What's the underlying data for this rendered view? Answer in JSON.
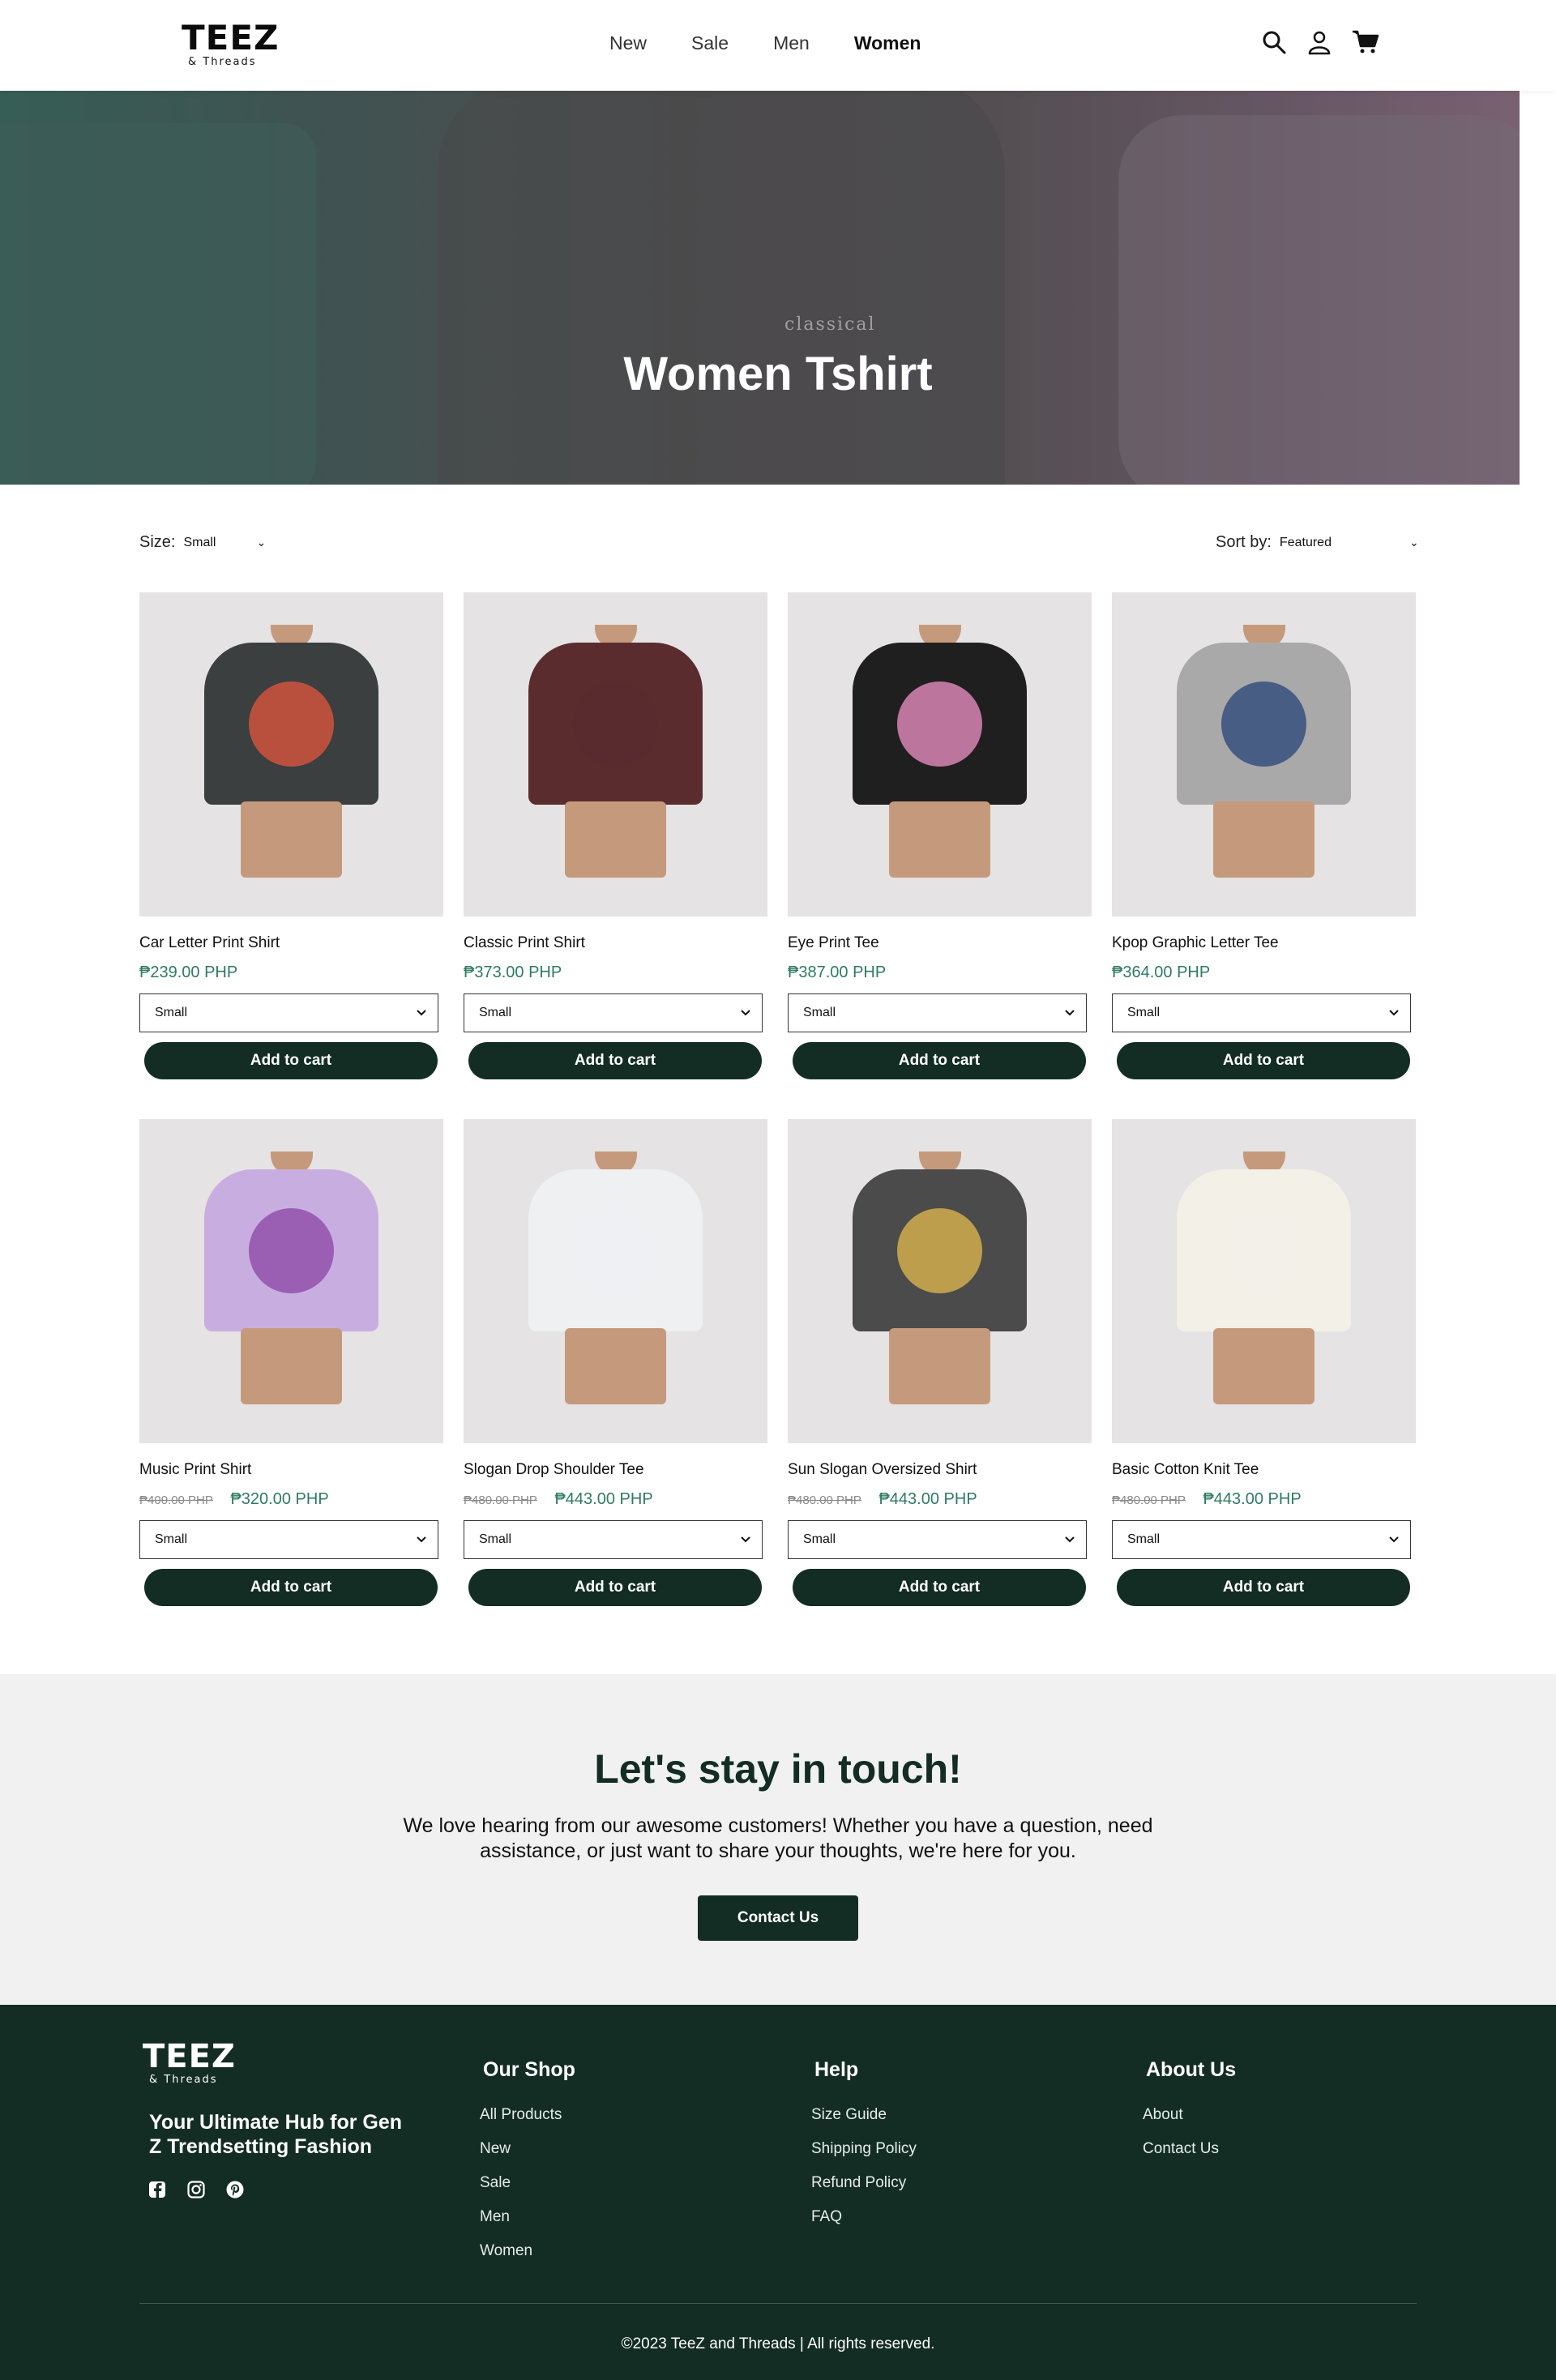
{
  "brand": {
    "name": "TEEZ",
    "sub": "& Threads"
  },
  "nav": [
    {
      "label": "New"
    },
    {
      "label": "Sale"
    },
    {
      "label": "Men"
    },
    {
      "label": "Women"
    }
  ],
  "header_icons": [
    "search-icon",
    "user-icon",
    "cart-icon"
  ],
  "hero": {
    "title": "Women Tshirt",
    "deco_text": "classical"
  },
  "filters": {
    "size_label": "Size:",
    "size_value": "Small",
    "sort_label": "Sort by:",
    "sort_value": "Featured"
  },
  "products": [
    {
      "name": "Car Letter Print Shirt",
      "price": "₱239.00 PHP",
      "old_price": "",
      "size": "Small",
      "button": "Add to cart",
      "tee_color": "#3c3f3f",
      "print_color": "#d8553f"
    },
    {
      "name": "Classic Print Shirt",
      "price": "₱373.00 PHP",
      "old_price": "",
      "size": "Small",
      "button": "Add to cart",
      "tee_color": "#5a2c2e",
      "print_color": "#5a2c2e"
    },
    {
      "name": "Eye Print Tee",
      "price": "₱387.00 PHP",
      "old_price": "",
      "size": "Small",
      "button": "Add to cart",
      "tee_color": "#1f1f1f",
      "print_color": "#e48bbd"
    },
    {
      "name": "Kpop Graphic Letter Tee",
      "price": "₱364.00 PHP",
      "old_price": "",
      "size": "Small",
      "button": "Add to cart",
      "tee_color": "#a9a9aa",
      "print_color": "#2f4a7a"
    },
    {
      "name": "Music Print Shirt",
      "price": "₱320.00 PHP",
      "old_price": "₱400.00 PHP",
      "size": "Small",
      "button": "Add to cart",
      "tee_color": "#c8aee0",
      "print_color": "#8e4aa8"
    },
    {
      "name": "Slogan Drop Shoulder Tee",
      "price": "₱443.00 PHP",
      "old_price": "₱480.00 PHP",
      "size": "Small",
      "button": "Add to cart",
      "tee_color": "#eef0f2",
      "print_color": "#eef0f2"
    },
    {
      "name": "Sun Slogan Oversized Shirt",
      "price": "₱443.00 PHP",
      "old_price": "₱480.00 PHP",
      "size": "Small",
      "button": "Add to cart",
      "tee_color": "#4b4b4b",
      "print_color": "#d9b34d"
    },
    {
      "name": "Basic Cotton Knit Tee",
      "price": "₱443.00 PHP",
      "old_price": "₱480.00 PHP",
      "size": "Small",
      "button": "Add to cart",
      "tee_color": "#f3f0e8",
      "print_color": "#f3f0e8"
    }
  ],
  "contact": {
    "title": "Let's stay in touch!",
    "text": "We love hearing from our awesome customers! Whether you have a question, need assistance, or just want to share your thoughts, we're here for you.",
    "button": "Contact Us"
  },
  "footer": {
    "tagline": "Your Ultimate Hub for Gen Z Trendsetting Fashion",
    "social": [
      "facebook-icon",
      "instagram-icon",
      "pinterest-icon"
    ],
    "columns": [
      {
        "title": "Our Shop",
        "links": [
          "All Products",
          "New",
          "Sale",
          "Men",
          "Women"
        ]
      },
      {
        "title": "Help",
        "links": [
          "Size Guide",
          "Shipping Policy",
          "Refund Policy",
          "FAQ"
        ]
      },
      {
        "title": "About Us",
        "links": [
          "About",
          "Contact Us"
        ]
      }
    ],
    "copyright": "©2023 TeeZ and Threads | All rights reserved."
  },
  "colors": {
    "accent": "#132d24",
    "price": "#2e7b62",
    "band": "#f1f1f1"
  }
}
